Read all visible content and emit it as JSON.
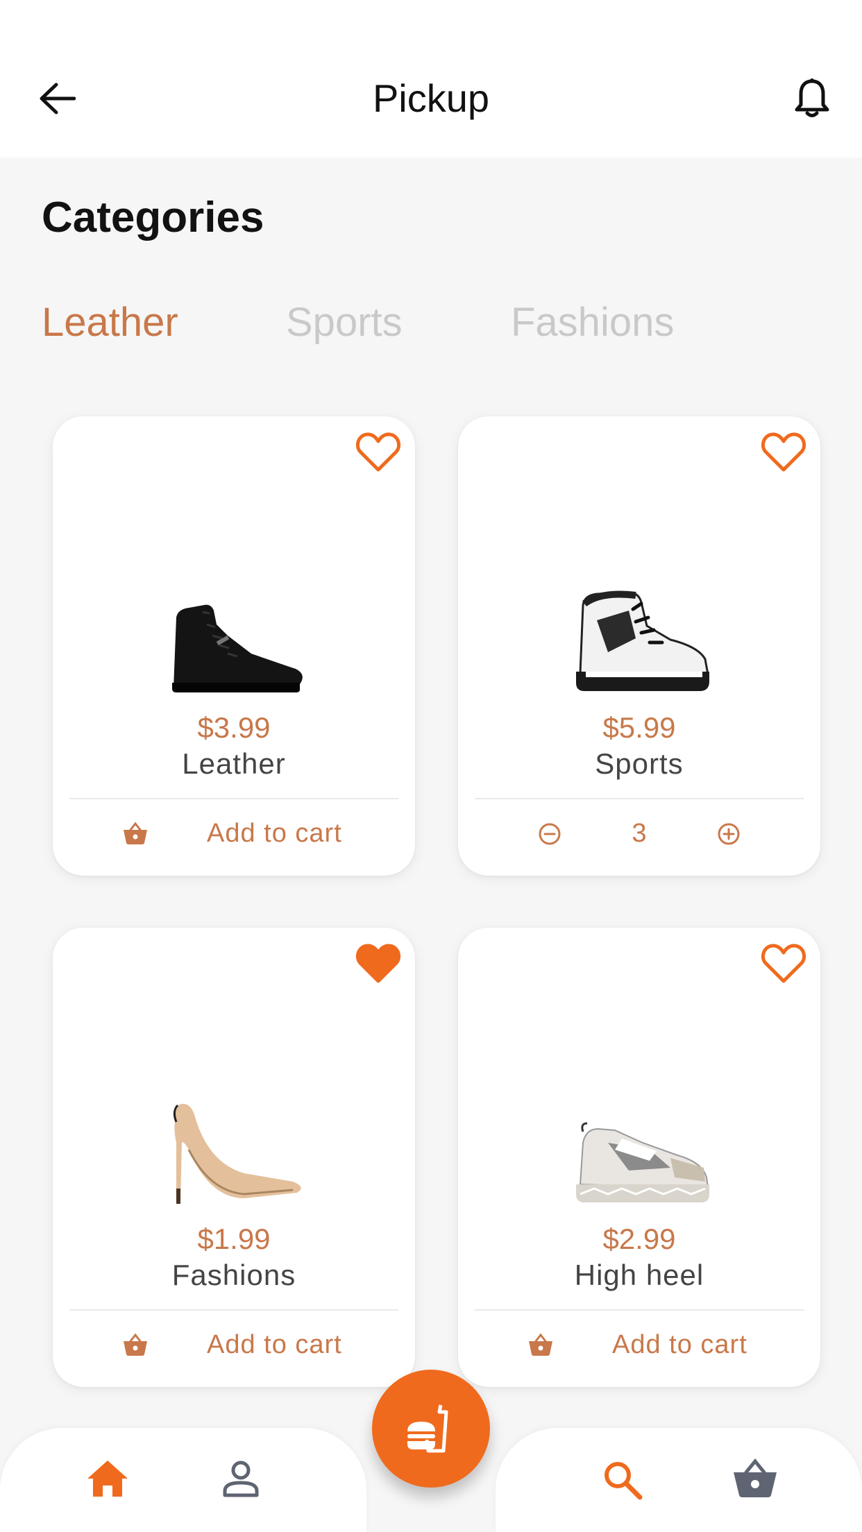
{
  "header": {
    "title": "Pickup",
    "back_icon": "arrow-left-icon",
    "notification_icon": "bell-icon"
  },
  "categories": {
    "title": "Categories",
    "tabs": [
      {
        "label": "Leather",
        "active": true
      },
      {
        "label": "Sports",
        "active": false
      },
      {
        "label": "Fashions",
        "active": false
      }
    ]
  },
  "products": [
    {
      "price": "$3.99",
      "name": "Leather",
      "favorited": false,
      "action": "add",
      "action_label": "Add to cart",
      "image": "black-leather-sneaker"
    },
    {
      "price": "$5.99",
      "name": "Sports",
      "favorited": false,
      "action": "stepper",
      "quantity": "3",
      "image": "white-hiking-boot"
    },
    {
      "price": "$1.99",
      "name": "Fashions",
      "favorited": true,
      "action": "add",
      "action_label": "Add to cart",
      "image": "nude-high-heel"
    },
    {
      "price": "$2.99",
      "name": "High heel",
      "favorited": false,
      "action": "add",
      "action_label": "Add to cart",
      "image": "chunky-sneaker"
    }
  ],
  "bottom_nav": {
    "items": [
      "home-icon",
      "profile-icon",
      "search-icon",
      "basket-icon"
    ],
    "center_button": "food-order-icon"
  },
  "colors": {
    "accent": "#f06a1d",
    "price": "#c8784a",
    "inactive_tab": "#c9c9c9",
    "nav_inactive": "#5f6473"
  }
}
